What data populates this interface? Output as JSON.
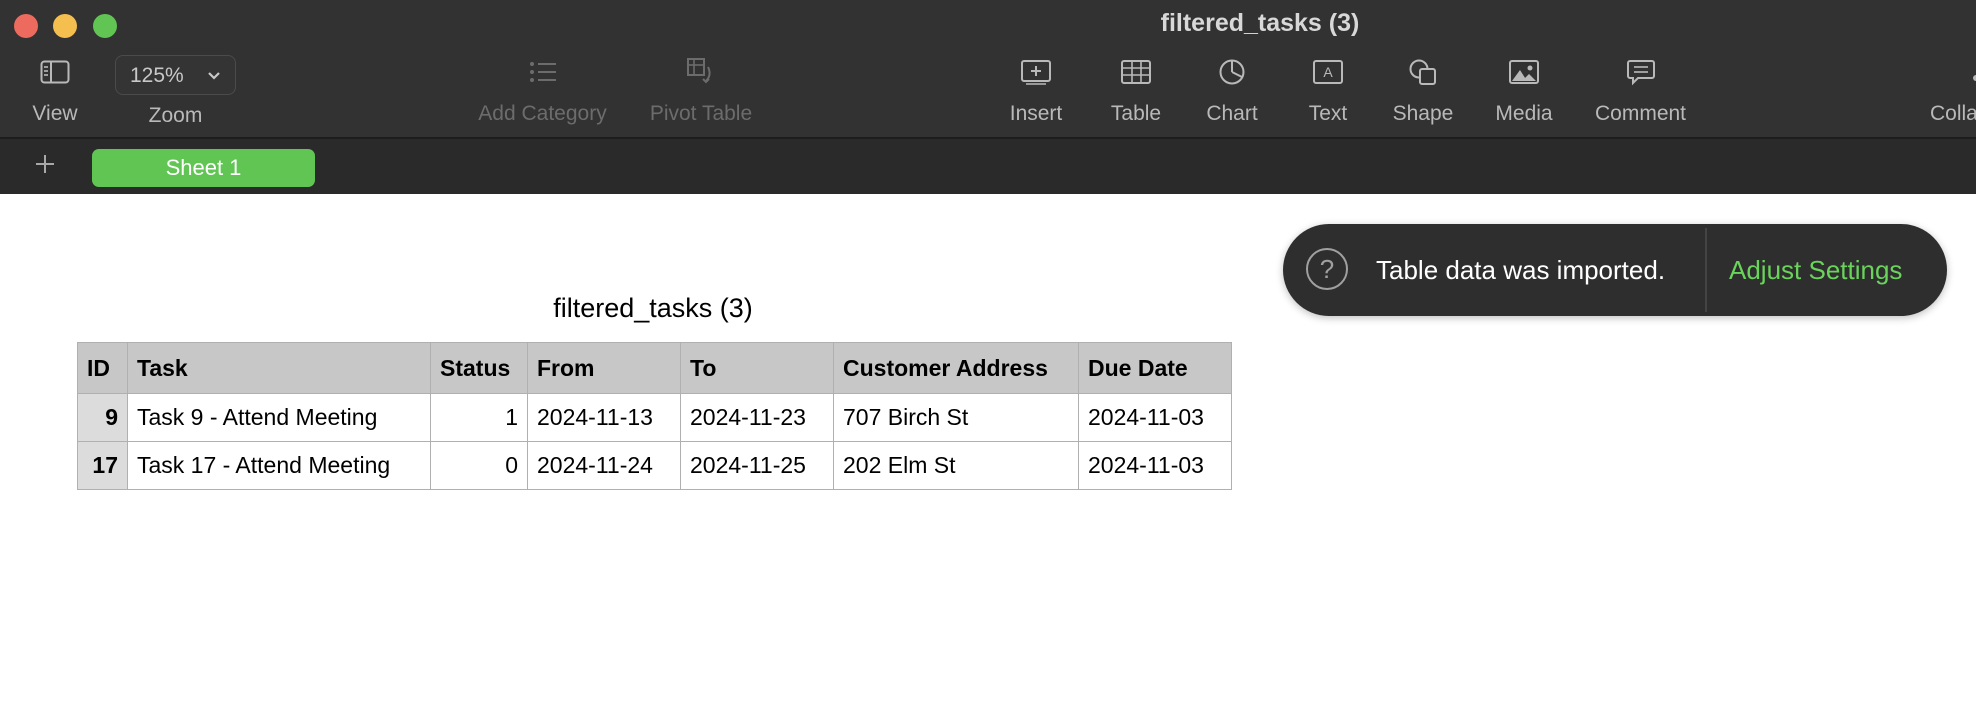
{
  "window": {
    "title": "filtered_tasks (3)"
  },
  "toolbar": {
    "view_label": "View",
    "zoom_value": "125%",
    "zoom_label": "Zoom",
    "add_category_label": "Add Category",
    "pivot_table_label": "Pivot Table",
    "insert_label": "Insert",
    "table_label": "Table",
    "chart_label": "Chart",
    "text_label": "Text",
    "shape_label": "Shape",
    "media_label": "Media",
    "comment_label": "Comment",
    "collab_label": "Colla"
  },
  "sheets": {
    "tabs": [
      {
        "label": "Sheet 1",
        "active": true
      }
    ]
  },
  "table": {
    "title": "filtered_tasks (3)",
    "columns": [
      "ID",
      "Task",
      "Status",
      "From",
      "To",
      "Customer Address",
      "Due Date"
    ],
    "rows": [
      [
        "9",
        "Task 9 - Attend Meeting",
        "1",
        "2024-11-13",
        "2024-11-23",
        "707 Birch St",
        "2024-11-03"
      ],
      [
        "17",
        "Task 17 - Attend Meeting",
        "0",
        "2024-11-24",
        "2024-11-25",
        "202 Elm St",
        "2024-11-03"
      ]
    ]
  },
  "notification": {
    "icon": "question-circle-icon",
    "message": "Table data was imported.",
    "action": "Adjust Settings",
    "action_color": "#6ad35c"
  },
  "colors": {
    "accent": "#61c554",
    "toolbar_bg": "#323232",
    "header_bg": "#c7c7c7"
  }
}
